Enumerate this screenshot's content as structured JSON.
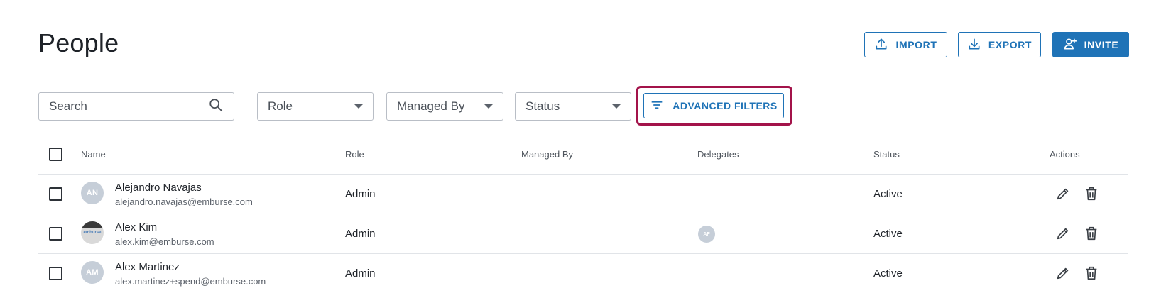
{
  "page": {
    "title": "People"
  },
  "header_actions": {
    "import_label": "IMPORT",
    "export_label": "EXPORT",
    "invite_label": "INVITE"
  },
  "filters": {
    "search_placeholder": "Search",
    "role_label": "Role",
    "managed_by_label": "Managed By",
    "status_label": "Status",
    "advanced_label": "ADVANCED FILTERS"
  },
  "table": {
    "columns": {
      "name": "Name",
      "role": "Role",
      "managed_by": "Managed By",
      "delegates": "Delegates",
      "status": "Status",
      "actions": "Actions"
    },
    "rows": [
      {
        "avatar_initials": "AN",
        "avatar_type": "initials",
        "name": "Alejandro Navajas",
        "email": "alejandro.navajas@emburse.com",
        "role": "Admin",
        "managed_by": "",
        "delegates": [],
        "status": "Active"
      },
      {
        "avatar_initials": "",
        "avatar_type": "photo",
        "avatar_photo_text": "emburse",
        "name": "Alex Kim",
        "email": "alex.kim@emburse.com",
        "role": "Admin",
        "managed_by": "",
        "delegates": [
          "AF"
        ],
        "status": "Active"
      },
      {
        "avatar_initials": "AM",
        "avatar_type": "initials",
        "name": "Alex Martinez",
        "email": "alex.martinez+spend@emburse.com",
        "role": "Admin",
        "managed_by": "",
        "delegates": [],
        "status": "Active"
      }
    ]
  },
  "colors": {
    "accent": "#1f73b7",
    "highlight_frame": "#a3134a",
    "avatar_bg": "#c6ced8"
  },
  "icons": {
    "import": "upload-icon",
    "export": "download-icon",
    "invite": "add-person-icon",
    "search": "search-icon",
    "advanced": "filter-lines-icon",
    "edit": "pencil-icon",
    "delete": "trash-icon"
  }
}
